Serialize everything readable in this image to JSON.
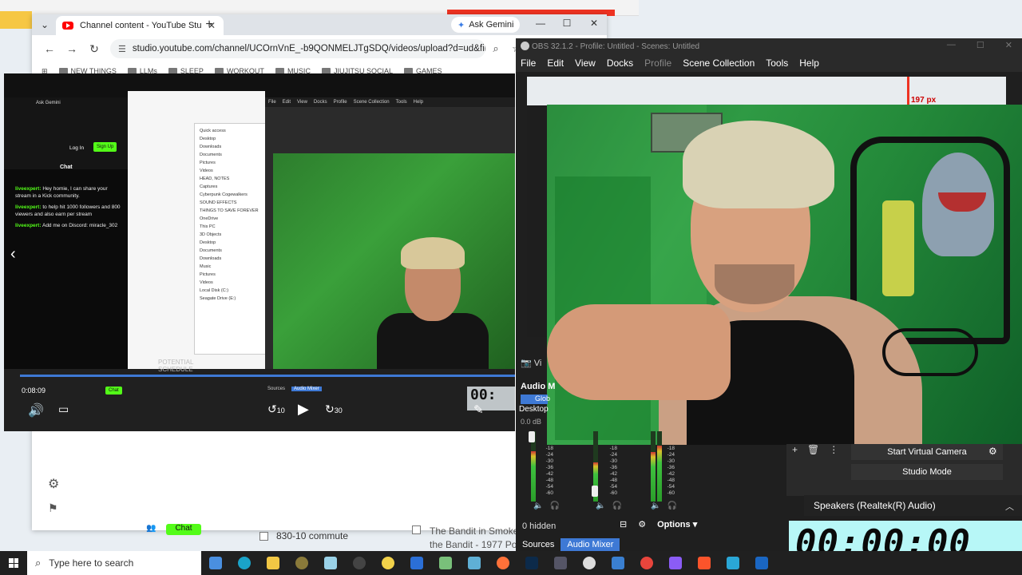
{
  "chrome": {
    "tab_title": "Channel content - YouTube Stu",
    "ask_gemini": "Ask Gemini",
    "url": "studio.youtube.com/channel/UCOrnVnE_-b9QONMELJTgSDQ/videos/upload?d=ud&filt...",
    "bookmarks": [
      "NEW THINGS",
      "LLMs",
      "SLEEP",
      "WORKOUT",
      "MUSIC",
      "JIUJITSU SOCIAL",
      "GAMES"
    ]
  },
  "capture": {
    "chat_title": "Chat",
    "login": "Log In",
    "signup": "Sign Up",
    "messages": [
      {
        "user": "liveexpert:",
        "text": "Hey homie, I can share your stream in a Kick community."
      },
      {
        "user": "liveexpert:",
        "text": "to help hit 1000 followers and 800 viewers and also earn per stream"
      },
      {
        "user": "liveexpert:",
        "text": "Add me on Discord: miracle_302"
      }
    ],
    "elapsed": "0:08:09",
    "chat_button": "Chat",
    "schedule": [
      "POTENTIAL",
      "SCHEDULE"
    ],
    "sources_tab": "Sources",
    "audio_mixer_tab": "Audio Mixer",
    "timer_mini": "00:",
    "explorer_items": [
      "Quick access",
      "Desktop",
      "Downloads",
      "Documents",
      "Pictures",
      "Videos",
      "HEAD, NOTES",
      "Captures",
      "Cyberpunk Cogewalkers",
      "SOUND EFFECTS",
      "THINGS TO SAVE FOREVER",
      "OneDrive",
      "This PC",
      "3D Objects",
      "Desktop",
      "Documents",
      "Downloads",
      "Music",
      "Pictures",
      "Videos",
      "Local Disk (C:)",
      "Seagate Drive (E:)"
    ],
    "skip_back": "10",
    "skip_fwd": "30"
  },
  "studio": {
    "kick_chat": "Chat",
    "check1": "830-10 commute",
    "bandit1": "The Bandit in Smokey",
    "bandit2": "the Bandit - 1977 Pon"
  },
  "obs": {
    "title": "OBS 32.1.2 - Profile: Untitled - Scenes: Untitled",
    "menu": [
      "File",
      "Edit",
      "View",
      "Docks",
      "Profile",
      "Scene Collection",
      "Tools",
      "Help"
    ],
    "px_readout": "197 px",
    "video_label": "Vi",
    "audio_title": "Audio M",
    "global_label": "Glob",
    "desktop_label": "Desktop",
    "db_value": "0.0 dB",
    "db_scale": [
      "-18",
      "-24",
      "-30",
      "-36",
      "-42",
      "-48",
      "-54",
      "-60"
    ],
    "hidden": "0 hidden",
    "options": "Options",
    "tabs": [
      "Sources",
      "Audio Mixer"
    ],
    "start_virtual_camera": "Start Virtual Camera",
    "studio_mode": "Studio Mode",
    "meter_levels": [
      0.72,
      0.56,
      0.7,
      0.8
    ]
  },
  "speakers": "Speakers (Realtek(R) Audio)",
  "timer": "00:00:00",
  "taskbar": {
    "search_placeholder": "Type here to search"
  }
}
